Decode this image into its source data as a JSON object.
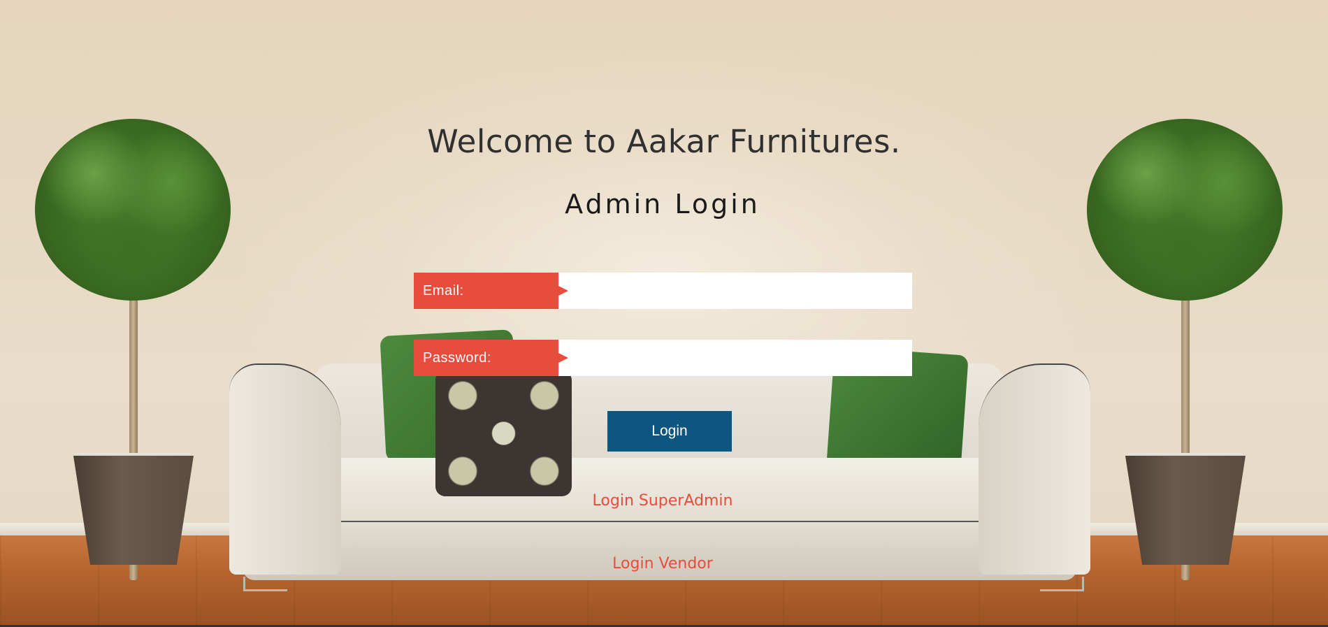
{
  "page": {
    "welcome_heading": "Welcome to Aakar Furnitures.",
    "form_title": "Admin Login"
  },
  "form": {
    "email": {
      "label": "Email:",
      "value": "",
      "placeholder": ""
    },
    "password": {
      "label": "Password:",
      "value": "",
      "placeholder": ""
    },
    "submit_label": "Login"
  },
  "links": {
    "superadmin": "Login SuperAdmin",
    "vendor": "Login Vendor"
  },
  "colors": {
    "accent_red": "#e84c3d",
    "button_blue": "#0c5680",
    "heading_text": "#303030"
  },
  "icons": {
    "label_pointer": "arrow-right-icon"
  }
}
